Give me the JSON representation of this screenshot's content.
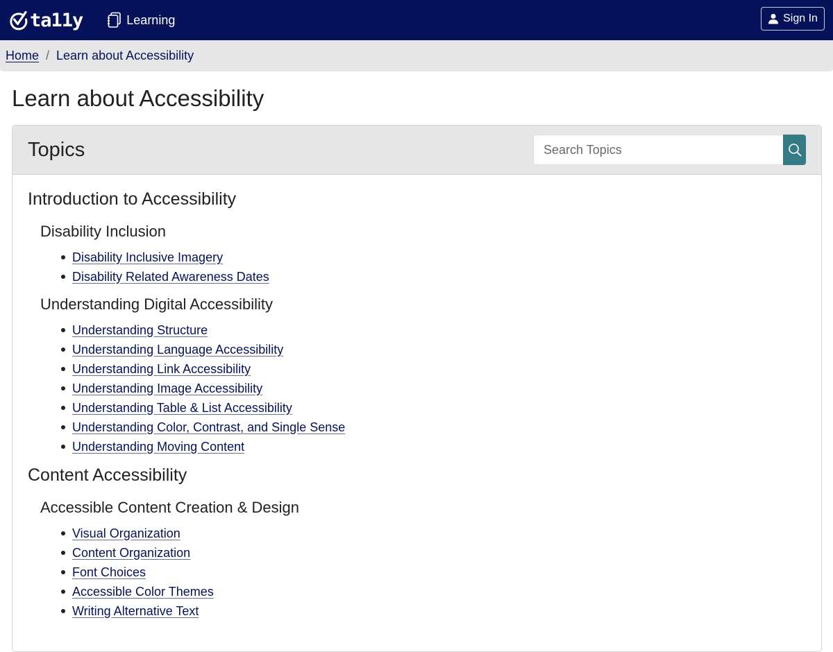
{
  "navbar": {
    "brand": "ta11y",
    "nav_link": "Learning",
    "sign_in": "Sign In",
    "background_color": "#06125a"
  },
  "breadcrumb": {
    "home": "Home",
    "separator": "/",
    "current": "Learn about Accessibility"
  },
  "page": {
    "title": "Learn about Accessibility"
  },
  "topics": {
    "title": "Topics",
    "search_placeholder": "Search Topics",
    "search_value": "",
    "search_button_color": "#357b85",
    "sections": [
      {
        "title": "Introduction to Accessibility",
        "subsections": [
          {
            "title": "Disability Inclusion",
            "links": [
              "Disability Inclusive Imagery",
              "Disability Related Awareness Dates"
            ]
          },
          {
            "title": "Understanding Digital Accessibility",
            "links": [
              "Understanding Structure",
              "Understanding Language Accessibility",
              "Understanding Link Accessibility",
              "Understanding Image Accessibility",
              "Understanding Table & List Accessibility",
              "Understanding Color, Contrast, and Single Sense",
              "Understanding Moving Content"
            ]
          }
        ]
      },
      {
        "title": "Content Accessibility",
        "subsections": [
          {
            "title": "Accessible Content Creation & Design",
            "links": [
              "Visual Organization",
              "Content Organization",
              "Font Choices",
              "Accessible Color Themes",
              "Writing Alternative Text"
            ]
          }
        ]
      }
    ]
  }
}
